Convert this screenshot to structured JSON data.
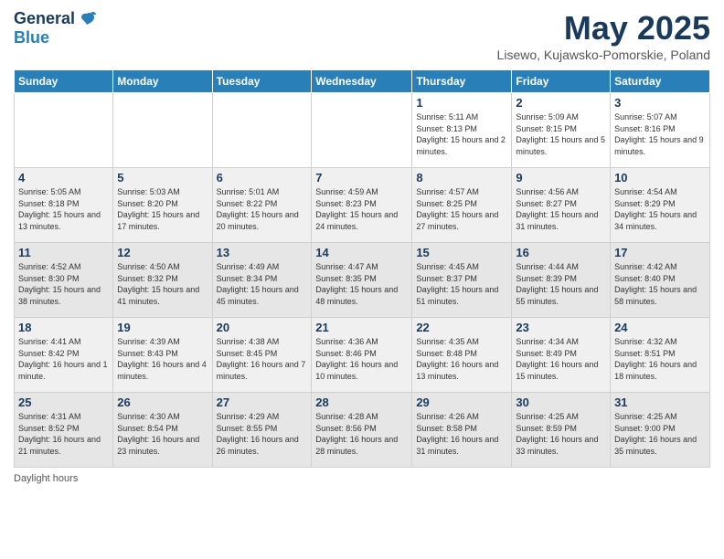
{
  "header": {
    "logo_general": "General",
    "logo_blue": "Blue",
    "month_title": "May 2025",
    "location": "Lisewo, Kujawsko-Pomorskie, Poland"
  },
  "columns": [
    "Sunday",
    "Monday",
    "Tuesday",
    "Wednesday",
    "Thursday",
    "Friday",
    "Saturday"
  ],
  "footer": {
    "daylight_label": "Daylight hours"
  },
  "weeks": [
    [
      {
        "day": "",
        "info": ""
      },
      {
        "day": "",
        "info": ""
      },
      {
        "day": "",
        "info": ""
      },
      {
        "day": "",
        "info": ""
      },
      {
        "day": "1",
        "info": "Sunrise: 5:11 AM\nSunset: 8:13 PM\nDaylight: 15 hours\nand 2 minutes."
      },
      {
        "day": "2",
        "info": "Sunrise: 5:09 AM\nSunset: 8:15 PM\nDaylight: 15 hours\nand 5 minutes."
      },
      {
        "day": "3",
        "info": "Sunrise: 5:07 AM\nSunset: 8:16 PM\nDaylight: 15 hours\nand 9 minutes."
      }
    ],
    [
      {
        "day": "4",
        "info": "Sunrise: 5:05 AM\nSunset: 8:18 PM\nDaylight: 15 hours\nand 13 minutes."
      },
      {
        "day": "5",
        "info": "Sunrise: 5:03 AM\nSunset: 8:20 PM\nDaylight: 15 hours\nand 17 minutes."
      },
      {
        "day": "6",
        "info": "Sunrise: 5:01 AM\nSunset: 8:22 PM\nDaylight: 15 hours\nand 20 minutes."
      },
      {
        "day": "7",
        "info": "Sunrise: 4:59 AM\nSunset: 8:23 PM\nDaylight: 15 hours\nand 24 minutes."
      },
      {
        "day": "8",
        "info": "Sunrise: 4:57 AM\nSunset: 8:25 PM\nDaylight: 15 hours\nand 27 minutes."
      },
      {
        "day": "9",
        "info": "Sunrise: 4:56 AM\nSunset: 8:27 PM\nDaylight: 15 hours\nand 31 minutes."
      },
      {
        "day": "10",
        "info": "Sunrise: 4:54 AM\nSunset: 8:29 PM\nDaylight: 15 hours\nand 34 minutes."
      }
    ],
    [
      {
        "day": "11",
        "info": "Sunrise: 4:52 AM\nSunset: 8:30 PM\nDaylight: 15 hours\nand 38 minutes."
      },
      {
        "day": "12",
        "info": "Sunrise: 4:50 AM\nSunset: 8:32 PM\nDaylight: 15 hours\nand 41 minutes."
      },
      {
        "day": "13",
        "info": "Sunrise: 4:49 AM\nSunset: 8:34 PM\nDaylight: 15 hours\nand 45 minutes."
      },
      {
        "day": "14",
        "info": "Sunrise: 4:47 AM\nSunset: 8:35 PM\nDaylight: 15 hours\nand 48 minutes."
      },
      {
        "day": "15",
        "info": "Sunrise: 4:45 AM\nSunset: 8:37 PM\nDaylight: 15 hours\nand 51 minutes."
      },
      {
        "day": "16",
        "info": "Sunrise: 4:44 AM\nSunset: 8:39 PM\nDaylight: 15 hours\nand 55 minutes."
      },
      {
        "day": "17",
        "info": "Sunrise: 4:42 AM\nSunset: 8:40 PM\nDaylight: 15 hours\nand 58 minutes."
      }
    ],
    [
      {
        "day": "18",
        "info": "Sunrise: 4:41 AM\nSunset: 8:42 PM\nDaylight: 16 hours\nand 1 minute."
      },
      {
        "day": "19",
        "info": "Sunrise: 4:39 AM\nSunset: 8:43 PM\nDaylight: 16 hours\nand 4 minutes."
      },
      {
        "day": "20",
        "info": "Sunrise: 4:38 AM\nSunset: 8:45 PM\nDaylight: 16 hours\nand 7 minutes."
      },
      {
        "day": "21",
        "info": "Sunrise: 4:36 AM\nSunset: 8:46 PM\nDaylight: 16 hours\nand 10 minutes."
      },
      {
        "day": "22",
        "info": "Sunrise: 4:35 AM\nSunset: 8:48 PM\nDaylight: 16 hours\nand 13 minutes."
      },
      {
        "day": "23",
        "info": "Sunrise: 4:34 AM\nSunset: 8:49 PM\nDaylight: 16 hours\nand 15 minutes."
      },
      {
        "day": "24",
        "info": "Sunrise: 4:32 AM\nSunset: 8:51 PM\nDaylight: 16 hours\nand 18 minutes."
      }
    ],
    [
      {
        "day": "25",
        "info": "Sunrise: 4:31 AM\nSunset: 8:52 PM\nDaylight: 16 hours\nand 21 minutes."
      },
      {
        "day": "26",
        "info": "Sunrise: 4:30 AM\nSunset: 8:54 PM\nDaylight: 16 hours\nand 23 minutes."
      },
      {
        "day": "27",
        "info": "Sunrise: 4:29 AM\nSunset: 8:55 PM\nDaylight: 16 hours\nand 26 minutes."
      },
      {
        "day": "28",
        "info": "Sunrise: 4:28 AM\nSunset: 8:56 PM\nDaylight: 16 hours\nand 28 minutes."
      },
      {
        "day": "29",
        "info": "Sunrise: 4:26 AM\nSunset: 8:58 PM\nDaylight: 16 hours\nand 31 minutes."
      },
      {
        "day": "30",
        "info": "Sunrise: 4:25 AM\nSunset: 8:59 PM\nDaylight: 16 hours\nand 33 minutes."
      },
      {
        "day": "31",
        "info": "Sunrise: 4:25 AM\nSunset: 9:00 PM\nDaylight: 16 hours\nand 35 minutes."
      }
    ]
  ]
}
